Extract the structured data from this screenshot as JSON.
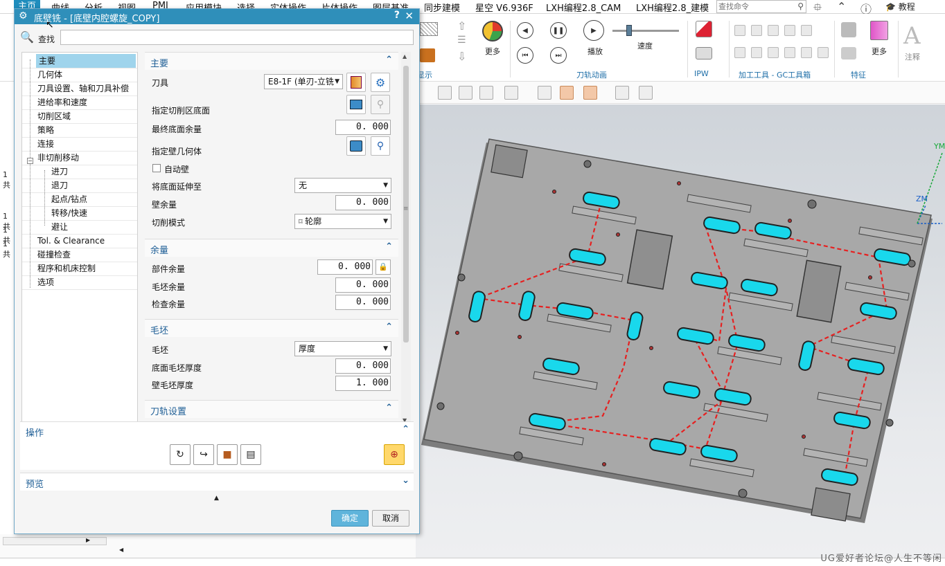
{
  "menubar": {
    "items": [
      "主页",
      "曲线",
      "分析",
      "视图",
      "PMI",
      "应用模块",
      "选择",
      "实体操作",
      "片体操作",
      "图层基准",
      "同步建模",
      "星空 V6.936F",
      "LXH编程2.8_CAM",
      "LXH编程2.8_建模"
    ],
    "search_placeholder": "查找命令",
    "tutorial": "教程"
  },
  "ribbon": {
    "more_label_1": "更多",
    "play_label": "播放",
    "speed_label": "速度",
    "more_label_2": "更多",
    "annotation_label": "注释",
    "group_display": "显示",
    "group_animation": "刀轨动画",
    "group_ipw": "IPW",
    "group_gc": "加工工具 - GC工具箱",
    "group_feature": "特征",
    "speed_fraction": 0.25
  },
  "left_strip": {
    "texts": [
      "1共",
      "1共",
      "1共",
      "1共"
    ]
  },
  "dialog": {
    "title": "底壁铣 - [底壁内腔螺旋_COPY]",
    "find_label": "查找",
    "nav": {
      "items": [
        "主要",
        "几何体",
        "刀具设置、轴和刀具补偿",
        "进给率和速度",
        "切削区域",
        "策略",
        "连接",
        "非切削移动",
        "进刀",
        "退刀",
        "起点/钻点",
        "转移/快速",
        "避让",
        "Tol. & Clearance",
        "碰撞检查",
        "程序和机床控制",
        "选项"
      ]
    },
    "main_section": {
      "title": "主要",
      "tool_label": "刀具",
      "tool_value": "E8-1F (单刃-立铣",
      "floor_label": "指定切削区底面",
      "final_floor_stock_label": "最终底面余量",
      "final_floor_stock": "0. 000",
      "wall_geom_label": "指定壁几何体",
      "auto_wall_label": "自动壁",
      "extend_floor_label": "将底面延伸至",
      "extend_floor_value": "无",
      "wall_stock_label": "壁余量",
      "wall_stock": "0. 000",
      "cut_pattern_label": "切削模式",
      "cut_pattern_value": "轮廓"
    },
    "stock_section": {
      "title": "余量",
      "part_stock_label": "部件余量",
      "part_stock": "0. 000",
      "blank_stock_label": "毛坯余量",
      "blank_stock": "0. 000",
      "check_stock_label": "检查余量",
      "check_stock": "0. 000"
    },
    "blank_section": {
      "title": "毛坯",
      "blank_label": "毛坯",
      "blank_value": "厚度",
      "floor_blank_label": "底面毛坯厚度",
      "floor_blank": "0. 000",
      "wall_blank_label": "壁毛坯厚度",
      "wall_blank": "1. 000"
    },
    "toolpath_section": {
      "title": "刀轨设置"
    },
    "operations_title": "操作",
    "preview_title": "预览",
    "ok_label": "确定",
    "cancel_label": "取消"
  },
  "viewport": {
    "axis_y": "YM",
    "axis_z": "ZM"
  },
  "watermark": "UG爱好者论坛@人生不等闲"
}
